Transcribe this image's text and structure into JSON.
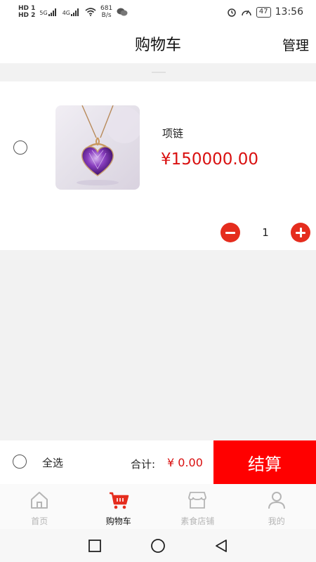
{
  "status_bar": {
    "hd1": "HD 1",
    "hd2": "HD 2",
    "signal1": "5G",
    "signal2": "4G",
    "net_speed": "681",
    "net_unit": "B/s",
    "battery": "47",
    "time": "13:56"
  },
  "header": {
    "title": "购物车",
    "manage_label": "管理"
  },
  "cart": {
    "items": [
      {
        "name": "项链",
        "price": "¥150000.00",
        "quantity": "1",
        "image_icon": "necklace-product-image",
        "selected": false
      }
    ]
  },
  "checkout": {
    "select_all_label": "全选",
    "total_label": "合计:",
    "total_value": "¥ 0.00",
    "checkout_label": "结算"
  },
  "tabs": [
    {
      "label": "首页",
      "icon": "home-icon",
      "active": false
    },
    {
      "label": "购物车",
      "icon": "cart-icon",
      "active": true
    },
    {
      "label": "素食店铺",
      "icon": "store-icon",
      "active": false
    },
    {
      "label": "我的",
      "icon": "profile-icon",
      "active": false
    }
  ],
  "colors": {
    "accent": "#ff0000",
    "price": "#d91010",
    "stepper": "#e52d1e",
    "active_tab_icon": "#e52d1e",
    "inactive_tab": "#b5b5b5"
  }
}
